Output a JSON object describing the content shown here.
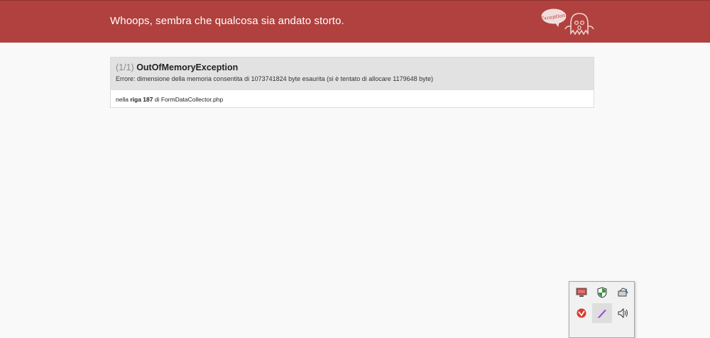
{
  "header": {
    "title": "Whoops, sembra che qualcosa sia andato storto.",
    "logo_text": "Exception!",
    "color": "#b0413e"
  },
  "exception": {
    "count": "(1/1)",
    "name": "OutOfMemoryException",
    "message": "Errore: dimensione della memoria consentita di 1073741824 byte esaurita (si è tentato di allocare 1179648 byte)",
    "location_prefix": "nella",
    "location_line": "riga 187",
    "location_of": "di",
    "location_file": "FormDataCollector.php"
  },
  "tray": {
    "icons": [
      "monitor-icon",
      "shield-icon",
      "network-icon",
      "antivirus-icon",
      "pen-icon",
      "volume-icon"
    ]
  }
}
